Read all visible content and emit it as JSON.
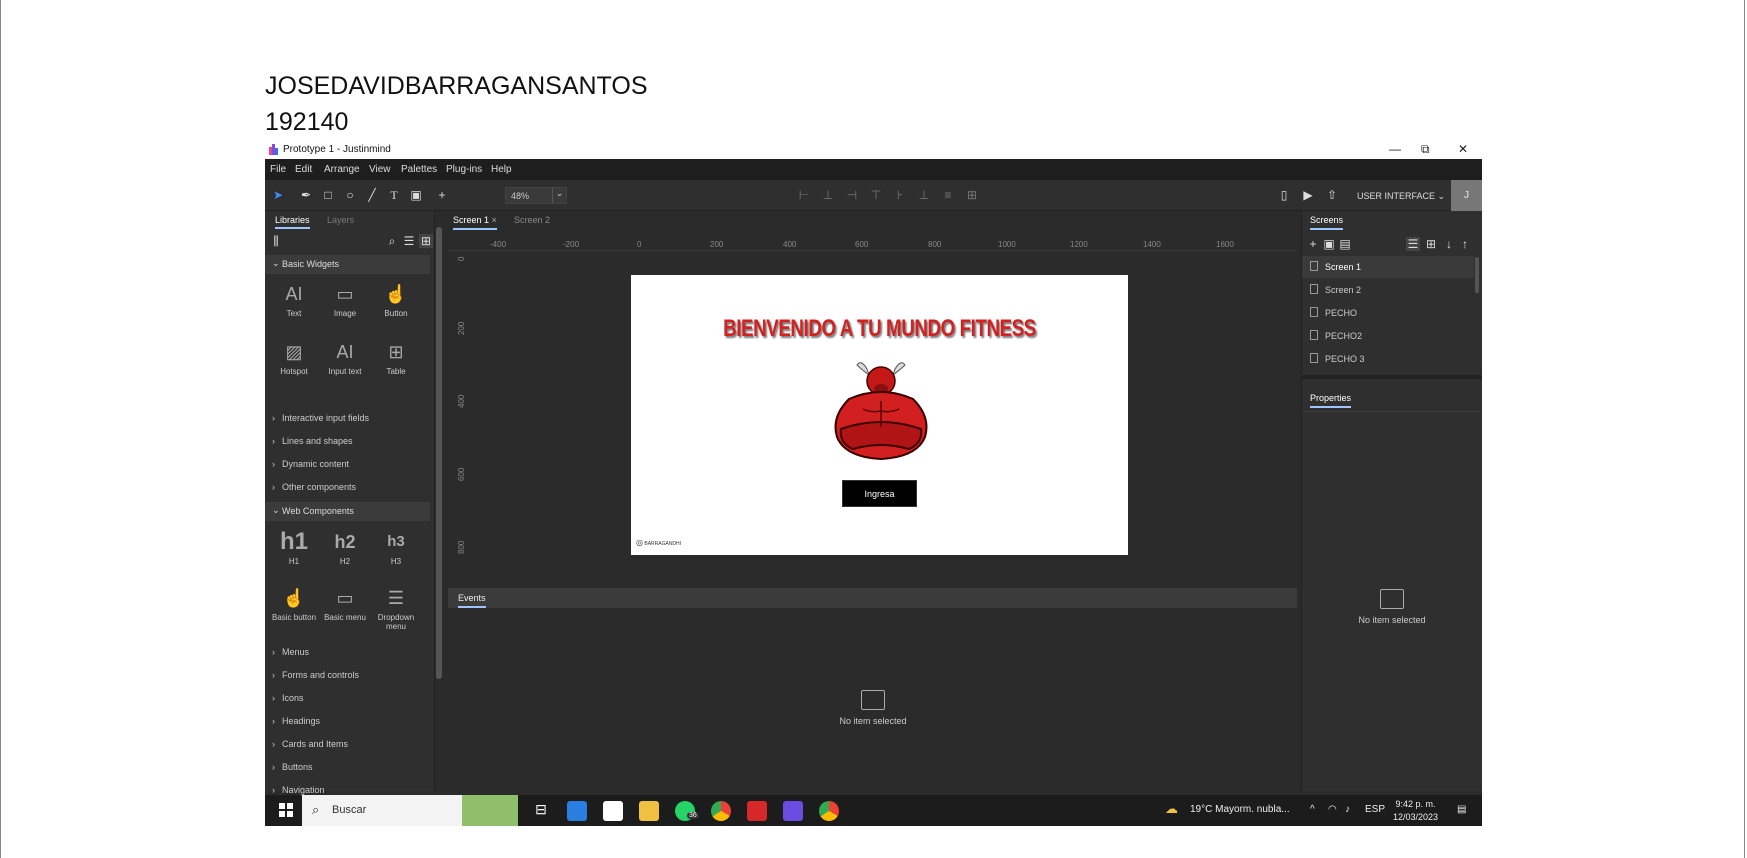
{
  "document": {
    "name_line": "JOSEDAVIDBARRAGANSANTOS",
    "id_line": "192140"
  },
  "window": {
    "title": "Prototype 1 - Justinmind",
    "controls": {
      "minimize": "—",
      "maximize": "⧉",
      "close": "✕"
    }
  },
  "menu": [
    "File",
    "Edit",
    "Arrange",
    "View",
    "Palettes",
    "Plug-ins",
    "Help"
  ],
  "toolbar": {
    "zoom_value": "48%",
    "ui_mode": "USER INTERFACE",
    "avatar_initial": "J"
  },
  "left_panel": {
    "tabs": [
      "Libraries",
      "Layers"
    ],
    "basic_widgets_title": "Basic Widgets",
    "basic_widgets": [
      {
        "label": "Text",
        "icon": "AI"
      },
      {
        "label": "Image",
        "icon": "▭"
      },
      {
        "label": "Button",
        "icon": "☝"
      },
      {
        "label": "Hotspot",
        "icon": "▨"
      },
      {
        "label": "Input text",
        "icon": "AI"
      },
      {
        "label": "Table",
        "icon": "⊞"
      }
    ],
    "collapsed_sections_1": [
      "Interactive input fields",
      "Lines and shapes",
      "Dynamic content",
      "Other components"
    ],
    "web_components_title": "Web Components",
    "web_components": [
      {
        "label": "H1",
        "icon": "h1"
      },
      {
        "label": "H2",
        "icon": "h2"
      },
      {
        "label": "H3",
        "icon": "h3"
      },
      {
        "label": "Basic button",
        "icon": "☝"
      },
      {
        "label": "Basic menu",
        "icon": "▭"
      },
      {
        "label": "Dropdown menu",
        "icon": "☰"
      }
    ],
    "collapsed_sections_2": [
      "Menus",
      "Forms and controls",
      "Icons",
      "Headings",
      "Cards and Items",
      "Buttons",
      "Navigation"
    ]
  },
  "canvas": {
    "tabs": [
      "Screen 1",
      "Screen 2"
    ],
    "ruler_top": [
      "-400",
      "-200",
      "0",
      "200",
      "400",
      "600",
      "800",
      "1000",
      "1200",
      "1400",
      "1600"
    ],
    "ruler_left": [
      "0",
      "200",
      "400",
      "600",
      "800"
    ],
    "artboard": {
      "headline": "BIENVENIDO A TU MUNDO FITNESS",
      "button_label": "Ingresa",
      "footer_brand": "BARRAGANDHI"
    },
    "events_tab": "Events",
    "no_item_text": "No item selected"
  },
  "right_panel": {
    "screens_tab": "Screens",
    "screens": [
      "Screen 1",
      "Screen 2",
      "PECHO",
      "PECHO2",
      "PECHO 3"
    ],
    "properties_tab": "Properties",
    "no_item_text": "No item selected"
  },
  "taskbar": {
    "search_placeholder": "Buscar",
    "whatsapp_badge": "36",
    "weather": "19°C  Mayorm. nubla...",
    "language": "ESP",
    "time": "9:42 p. m.",
    "date": "12/03/2023"
  },
  "colors": {
    "headline_red": "#d32020",
    "accent_blue": "#9ec5ff",
    "panel_dark": "#2f2f2f"
  }
}
